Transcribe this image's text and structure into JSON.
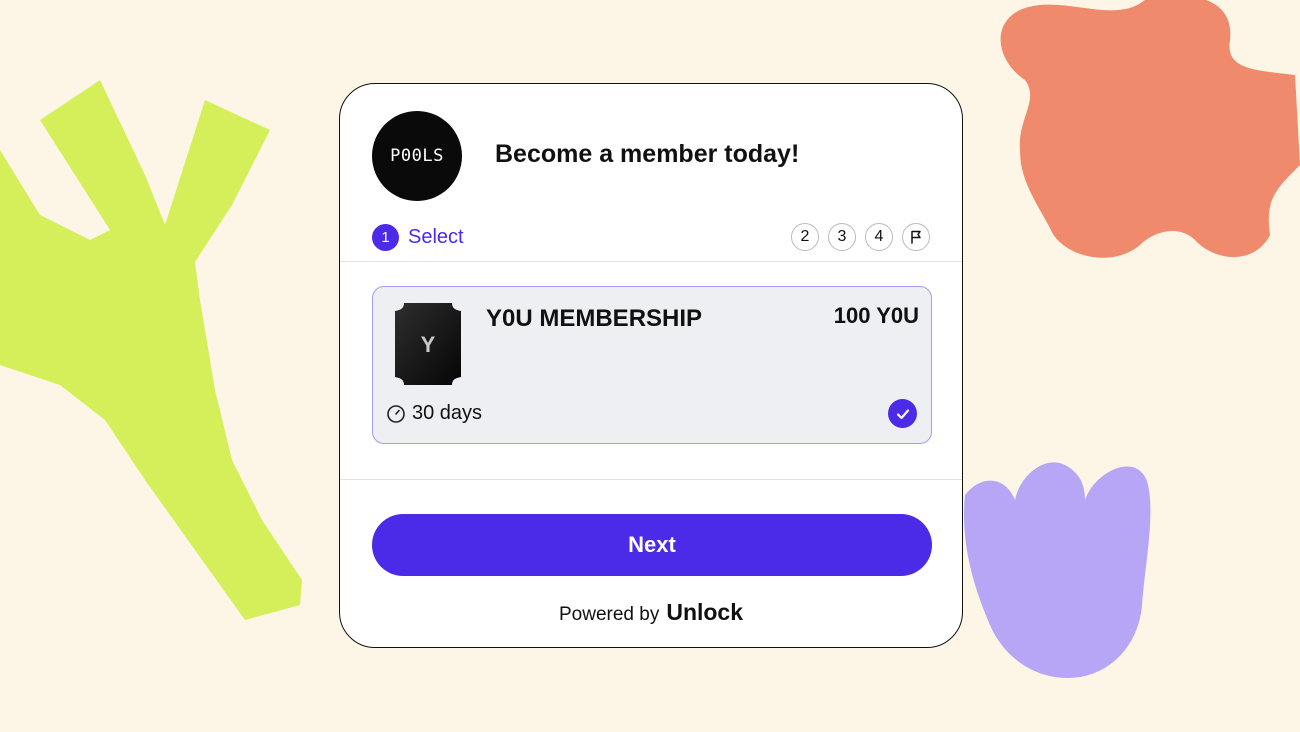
{
  "header": {
    "logo_text": "P00LS",
    "title": "Become a member today!"
  },
  "steps": {
    "current": {
      "number": "1",
      "label": "Select"
    },
    "upcoming": [
      "2",
      "3",
      "4"
    ],
    "final_icon": "flag-icon"
  },
  "plan": {
    "name": "Y0U MEMBERSHIP",
    "price": "100 Y0U",
    "duration": "30 days",
    "duration_icon": "clock-icon",
    "thumb_letter": "Y",
    "selected": true
  },
  "actions": {
    "next_label": "Next"
  },
  "footer": {
    "powered_by": "Powered by",
    "brand": "Unlock"
  },
  "colors": {
    "accent": "#4b2ae8",
    "page_background": "#fdf6e7",
    "shape_green": "#d5ef5a",
    "shape_coral": "#ef8a6c",
    "shape_lavender": "#b6a6f5"
  }
}
